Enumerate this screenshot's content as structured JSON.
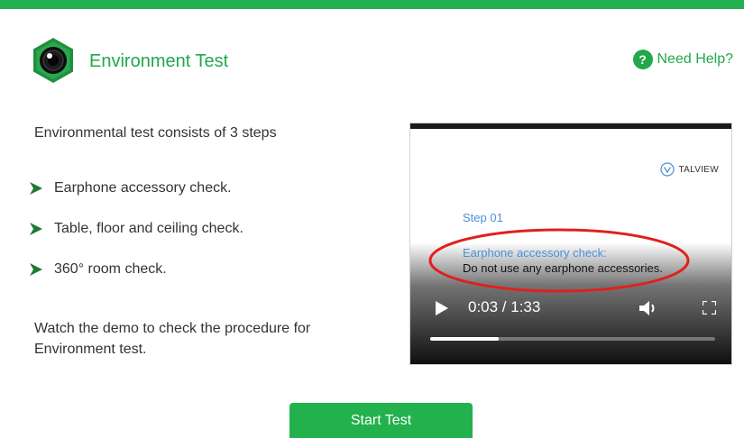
{
  "colors": {
    "brand_green": "#22b14c",
    "link_blue": "#4a90d9",
    "annotation_red": "#e0201b"
  },
  "header": {
    "title": "Environment Test",
    "icon": "camera-lens-icon",
    "help_label": "Need Help?",
    "help_icon": "question-mark-icon"
  },
  "content": {
    "intro": "Environmental test consists of 3 steps",
    "steps": [
      {
        "label": "Earphone accessory check.",
        "icon": "chevron-right-icon"
      },
      {
        "label": "Table, floor and ceiling check.",
        "icon": "chevron-right-icon"
      },
      {
        "label": "360° room check.",
        "icon": "chevron-right-icon"
      }
    ],
    "outro": "Watch the demo to check the procedure for Environment test."
  },
  "video": {
    "brand": "TALVIEW",
    "step_number": "Step 01",
    "step_name": "Earphone accessory check:",
    "step_desc": "Do not use any earphone accessories.",
    "time": "0:03 / 1:33",
    "progress_fraction": 0.24,
    "controls": {
      "play": "play-icon",
      "volume": "volume-icon",
      "fullscreen": "fullscreen-icon"
    }
  },
  "actions": {
    "start_label": "Start Test"
  }
}
